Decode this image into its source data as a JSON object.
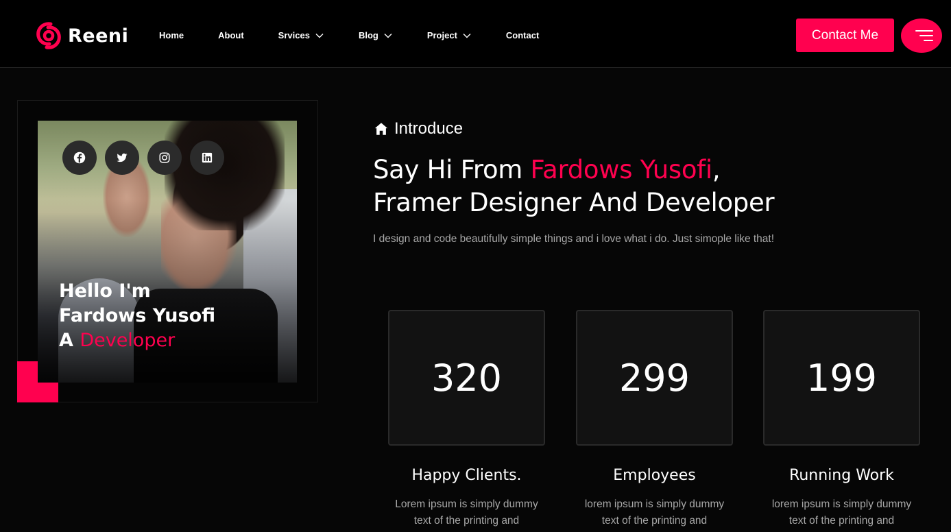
{
  "brand": {
    "name": "Reeni",
    "accent_color": "#ff014f",
    "logo_icon": "reeni-logo-icon"
  },
  "nav": {
    "items": [
      {
        "label": "Home",
        "dropdown": false
      },
      {
        "label": "About",
        "dropdown": false
      },
      {
        "label": "Srvices",
        "dropdown": true
      },
      {
        "label": "Blog",
        "dropdown": true
      },
      {
        "label": "Project",
        "dropdown": true
      },
      {
        "label": "Contact",
        "dropdown": false
      }
    ],
    "dropdown_icon": "chevron-down-icon"
  },
  "header": {
    "contact_button": "Contact Me",
    "menu_icon": "hamburger-menu-icon"
  },
  "profile_card": {
    "social_icons": [
      "facebook-icon",
      "twitter-icon",
      "instagram-icon",
      "linkedin-icon"
    ],
    "greeting_line1": "Hello I'm",
    "greeting_line2": "Fardows Yusofi",
    "greeting_prefix": "A",
    "greeting_role": "Developer"
  },
  "intro": {
    "label": "Introduce",
    "label_icon": "home-icon",
    "headline_prefix": "Say Hi From ",
    "headline_name": "Fardows Yusofi",
    "headline_comma": ",",
    "headline_line2": "Framer Designer And Developer",
    "description": "I design and code beautifully simple things and i love what i do. Just simople like that!"
  },
  "stats": [
    {
      "value": "320",
      "title": "Happy Clients.",
      "desc_line1": "Lorem ipsum is simply dummy",
      "desc_line2": "text of the printing and"
    },
    {
      "value": "299",
      "title": "Employees",
      "desc_line1": "lorem ipsum is simply dummy",
      "desc_line2": "text of the printing and"
    },
    {
      "value": "199",
      "title": "Running Work",
      "desc_line1": "lorem ipsum is simply dummy",
      "desc_line2": "text of the printing and"
    }
  ]
}
